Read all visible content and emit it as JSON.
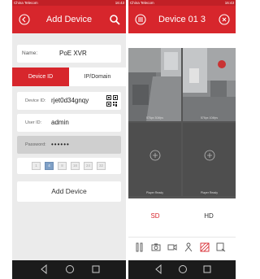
{
  "left_screen": {
    "status": {
      "carrier": "China Telecom",
      "right": "16:43"
    },
    "header": {
      "title": "Add Device"
    },
    "name": {
      "label": "Name:",
      "value": "PoE XVR"
    },
    "tabs": [
      {
        "label": "Device ID"
      },
      {
        "label": "IP/Domain"
      }
    ],
    "device_id": {
      "label": "Device ID:",
      "value": "rjet0d34gnqy"
    },
    "user_id": {
      "label": "User ID:",
      "value": "admin"
    },
    "password": {
      "label": "Password:",
      "value": "••••••"
    },
    "slot_numbers": [
      "1",
      "4",
      "8",
      "16",
      "24",
      "32"
    ],
    "add_button": "Add Device",
    "colors": {
      "accent": "#d7262c",
      "status_bar": "#c12026",
      "slot_active": "#7fa0c6"
    }
  },
  "right_screen": {
    "status": {
      "carrier": "China Telecom",
      "right": "16:43"
    },
    "header": {
      "title": "Device 01 3"
    },
    "cells": [
      {
        "label": "576px 304fps"
      },
      {
        "label": "576px 104fps"
      },
      {
        "label": "Player Ready"
      },
      {
        "label": "Player Ready"
      }
    ],
    "quality": {
      "sd": "SD",
      "hd": "HD"
    },
    "colors": {
      "sd_color": "#d7262c",
      "hd_color": "#333333"
    }
  }
}
